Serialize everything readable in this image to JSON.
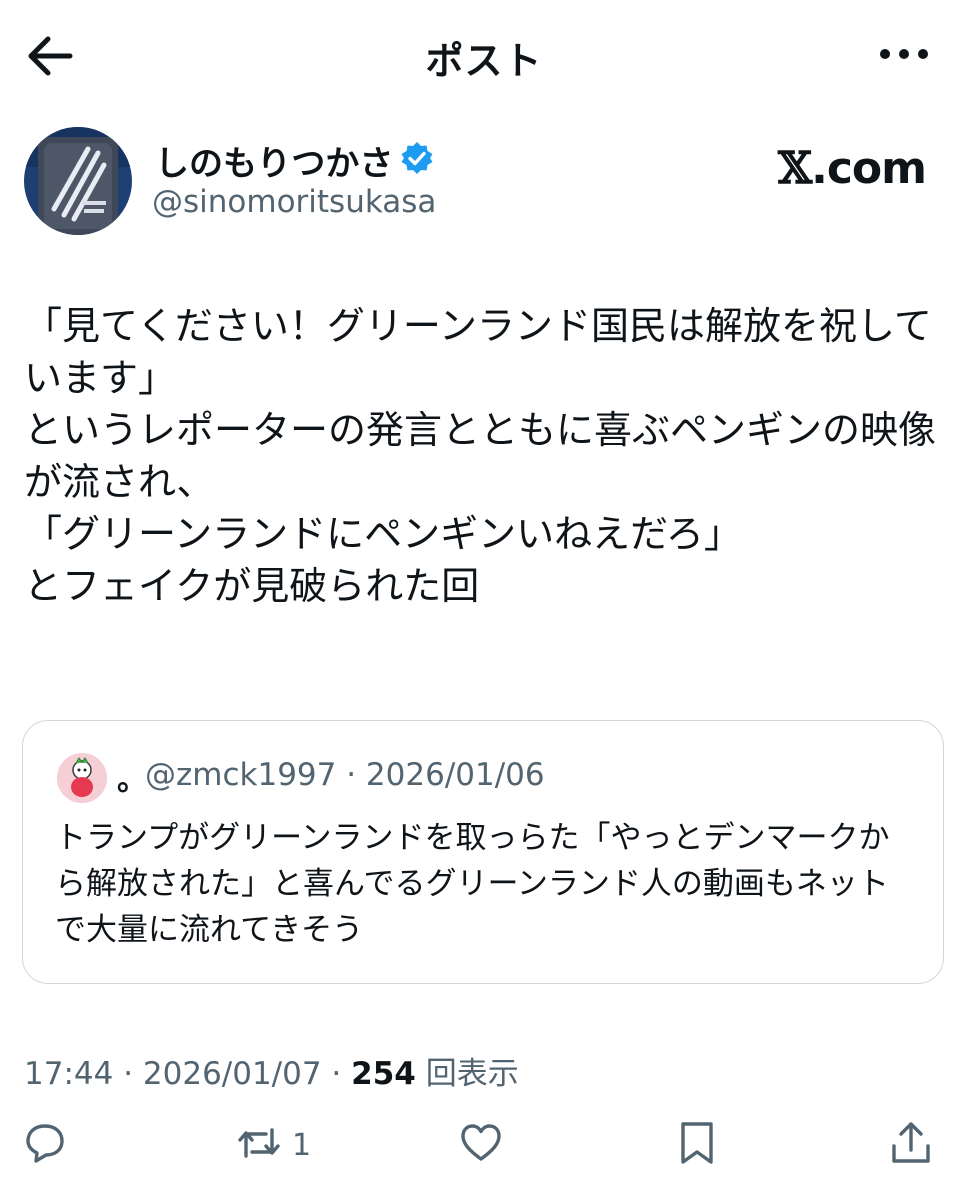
{
  "header": {
    "title": "ポスト",
    "back_icon": "arrow-left-icon",
    "more_icon": "more-dots-icon"
  },
  "author": {
    "display_name": "しのもりつかさ",
    "handle": "@sinomoritsukasa",
    "verified_icon": "verified-badge-icon",
    "verified_color": "#1d9bf0"
  },
  "watermark": {
    "x": "𝕏",
    "rest": ".com"
  },
  "tweet": {
    "text": "「見てください！グリーンランド国民は解放を祝しています」\nというレポーターの発言とともに喜ぶペンギンの映像が流され、\n「グリーンランドにペンギンいねえだろ」\nとフェイクが見破られた回"
  },
  "quote": {
    "name": "。",
    "meta": "@zmck1997 · 2026/01/06",
    "text": "トランプがグリーンランドを取っらた「やっとデンマークから解放された」と喜んでるグリーンランド人の動画もネットで大量に流れてきそう"
  },
  "meta": {
    "time_date": "17:44 · 2026/01/07 · ",
    "views": "254",
    "views_label": " 回表示"
  },
  "actions": {
    "reply_icon": "reply-icon",
    "retweet_icon": "retweet-icon",
    "retweet_count": "1",
    "like_icon": "heart-icon",
    "bookmark_icon": "bookmark-icon",
    "share_icon": "share-icon"
  },
  "colors": {
    "text": "#0f1419",
    "secondary": "#536471",
    "border": "#cfd9de",
    "accent": "#1d9bf0"
  }
}
